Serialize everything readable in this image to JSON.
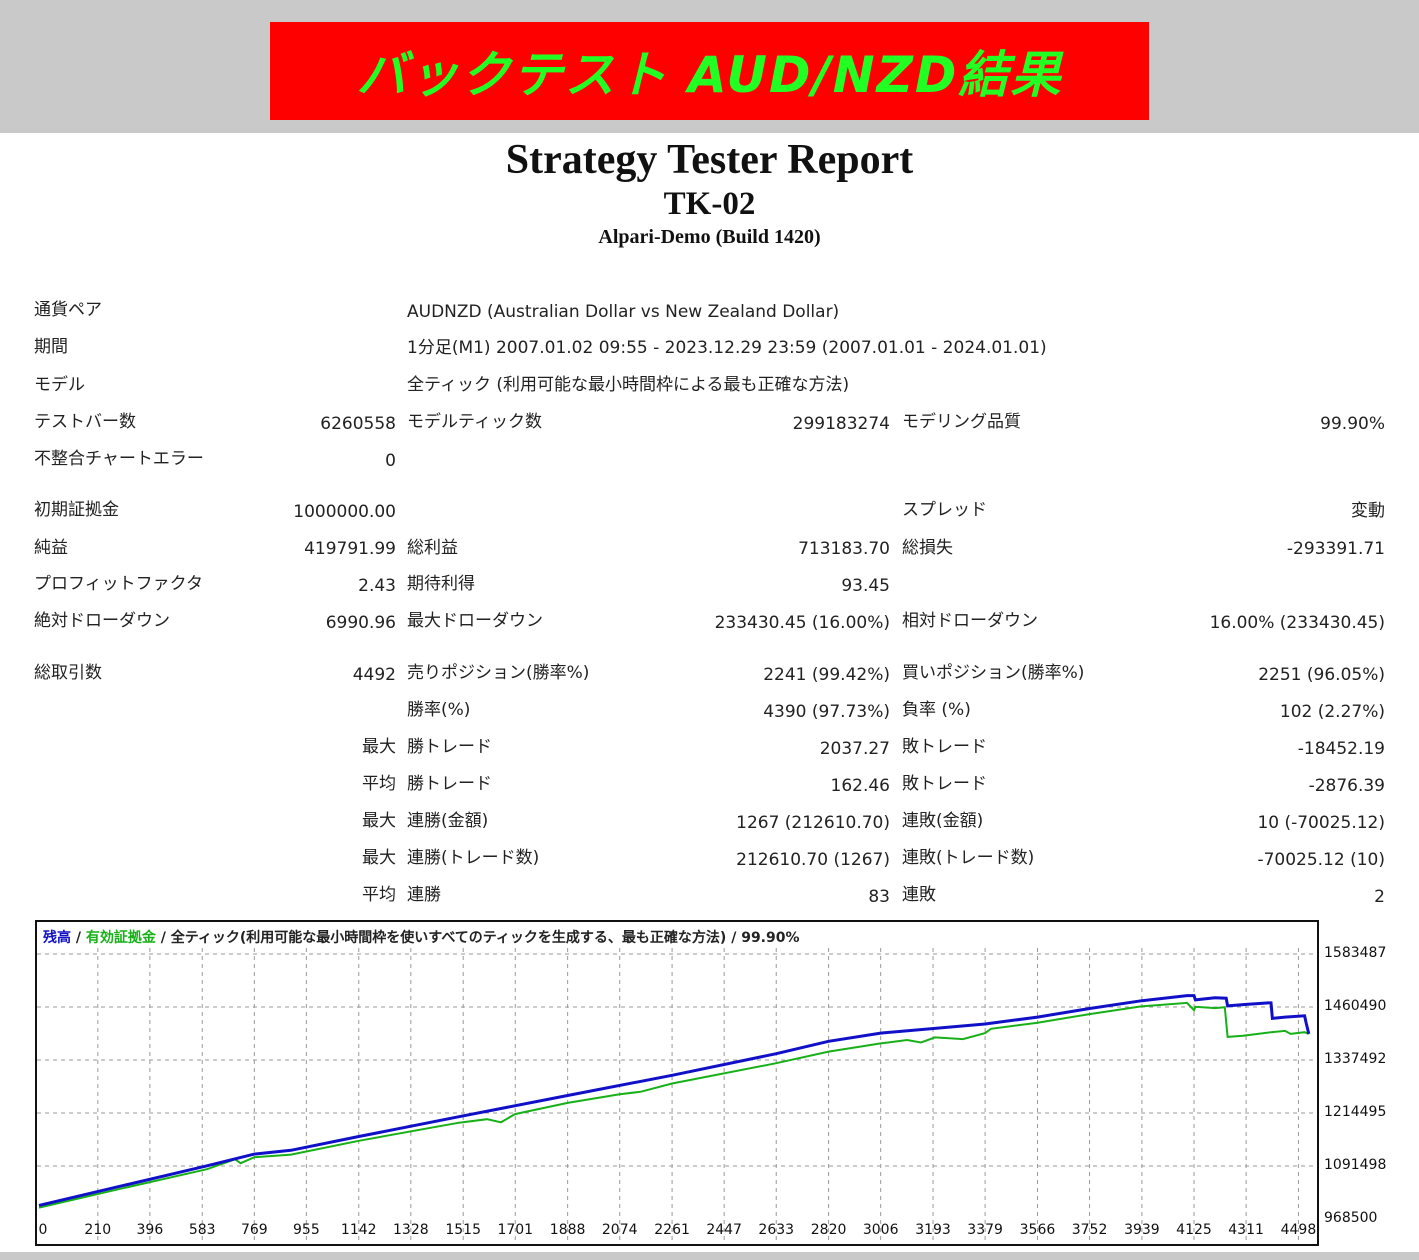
{
  "banner": {
    "text": "バックテスト AUD/NZD結果",
    "bg": "#ff0000",
    "fg": "#22ff22"
  },
  "report": {
    "title": "Strategy Tester Report",
    "ea": "TK-02",
    "server": "Alpari-Demo (Build 1420)"
  },
  "rows": {
    "symbol": {
      "label": "通貨ペア",
      "value": "AUDNZD (Australian Dollar vs New Zealand Dollar)"
    },
    "period": {
      "label": "期間",
      "value": "1分足(M1) 2007.01.02 09:55 - 2023.12.29 23:59 (2007.01.01 - 2024.01.01)"
    },
    "model": {
      "label": "モデル",
      "value": "全ティック (利用可能な最小時間枠による最も正確な方法)"
    },
    "bars": {
      "label": "テストバー数",
      "value": "6260558",
      "label2": "モデルティック数",
      "value2": "299183274",
      "label3": "モデリング品質",
      "value3": "99.90%"
    },
    "mismatch": {
      "label": "不整合チャートエラー",
      "value": "0"
    },
    "deposit": {
      "label": "初期証拠金",
      "value": "1000000.00",
      "label3": "スプレッド",
      "value3": "変動"
    },
    "net": {
      "label": "純益",
      "value": "419791.99",
      "label2": "総利益",
      "value2": "713183.70",
      "label3": "総損失",
      "value3": "-293391.71"
    },
    "pf": {
      "label": "プロフィットファクタ",
      "value": "2.43",
      "label2": "期待利得",
      "value2": "93.45"
    },
    "dd": {
      "label": "絶対ドローダウン",
      "value": "6990.96",
      "label2": "最大ドローダウン",
      "value2": "233430.45 (16.00%)",
      "label3": "相対ドローダウン",
      "value3": "16.00% (233430.45)"
    },
    "trades": {
      "label": "総取引数",
      "value": "4492",
      "label2": "売りポジション(勝率%)",
      "value2": "2241 (99.42%)",
      "label3": "買いポジション(勝率%)",
      "value3": "2251 (96.05%)"
    },
    "winrate": {
      "label2": "勝率(%)",
      "value2": "4390 (97.73%)",
      "label3": "負率 (%)",
      "value3": "102 (2.27%)"
    },
    "largest": {
      "prefix": "最大",
      "label2": "勝トレード",
      "value2": "2037.27",
      "label3": "敗トレード",
      "value3": "-18452.19"
    },
    "average": {
      "prefix": "平均",
      "label2": "勝トレード",
      "value2": "162.46",
      "label3": "敗トレード",
      "value3": "-2876.39"
    },
    "max_cons_money": {
      "prefix": "最大",
      "label2": "連勝(金額)",
      "value2": "1267 (212610.70)",
      "label3": "連敗(金額)",
      "value3": "10 (-70025.12)"
    },
    "max_cons_count": {
      "prefix": "最大",
      "label2": "連勝(トレード数)",
      "value2": "212610.70 (1267)",
      "label3": "連敗(トレード数)",
      "value3": "-70025.12 (10)"
    },
    "avg_cons": {
      "prefix": "平均",
      "label2": "連勝",
      "value2": "83",
      "label3": "連敗",
      "value3": "2"
    }
  },
  "chart_data": {
    "type": "line",
    "legend": {
      "balance": "残高",
      "equity": "有効証拠金",
      "desc": "全ティック(利用可能な最小時間枠を使いすべてのティックを生成する、最も正確な方法)",
      "quality": "99.90%",
      "sep": "/"
    },
    "x_ticks": [
      "0",
      "210",
      "396",
      "583",
      "769",
      "955",
      "1142",
      "1328",
      "1515",
      "1701",
      "1888",
      "2074",
      "2261",
      "2447",
      "2633",
      "2820",
      "3006",
      "3193",
      "3379",
      "3566",
      "3752",
      "3939",
      "4125",
      "4311",
      "4498"
    ],
    "y_ticks": [
      "1583487",
      "1460490",
      "1337492",
      "1214495",
      "1091498",
      "968500"
    ],
    "xlim": [
      0,
      4550
    ],
    "ylim": [
      968500,
      1600000
    ],
    "colors": {
      "balance": "#1010c8",
      "equity": "#18b018",
      "grid": "#9a9a9a"
    },
    "series": [
      {
        "name": "残高",
        "x": [
          0,
          300,
          600,
          769,
          900,
          1142,
          1500,
          1888,
          2261,
          2633,
          2820,
          3006,
          3379,
          3566,
          3752,
          3939,
          4100,
          4125,
          4130,
          4200,
          4240,
          4245,
          4300,
          4390,
          4400,
          4405,
          4450,
          4520,
          4525,
          4535
        ],
        "y": [
          1000000,
          1046000,
          1092000,
          1119000,
          1128000,
          1160000,
          1206000,
          1255000,
          1302000,
          1352000,
          1381000,
          1400000,
          1421000,
          1437000,
          1457000,
          1475000,
          1487000,
          1487000,
          1477000,
          1482000,
          1481000,
          1463000,
          1466000,
          1470000,
          1470000,
          1434000,
          1437000,
          1440000,
          1425000,
          1398000
        ]
      },
      {
        "name": "有効証拠金",
        "x": [
          0,
          300,
          600,
          700,
          720,
          769,
          900,
          1142,
          1500,
          1600,
          1650,
          1700,
          1888,
          2074,
          2150,
          2261,
          2633,
          2820,
          3006,
          3100,
          3150,
          3200,
          3300,
          3379,
          3400,
          3566,
          3752,
          3939,
          4100,
          4125,
          4130,
          4200,
          4235,
          4245,
          4300,
          4400,
          4450,
          4470,
          4520,
          4535
        ],
        "y": [
          995000,
          1040000,
          1084000,
          1107000,
          1098000,
          1112000,
          1118000,
          1150000,
          1192000,
          1200000,
          1193000,
          1212000,
          1238000,
          1258000,
          1264000,
          1283000,
          1330000,
          1357000,
          1376000,
          1384000,
          1378000,
          1390000,
          1386000,
          1400000,
          1410000,
          1424000,
          1444000,
          1462000,
          1470000,
          1453000,
          1461000,
          1458000,
          1460000,
          1391000,
          1394000,
          1402000,
          1405000,
          1398000,
          1402000,
          1398000
        ]
      }
    ]
  }
}
